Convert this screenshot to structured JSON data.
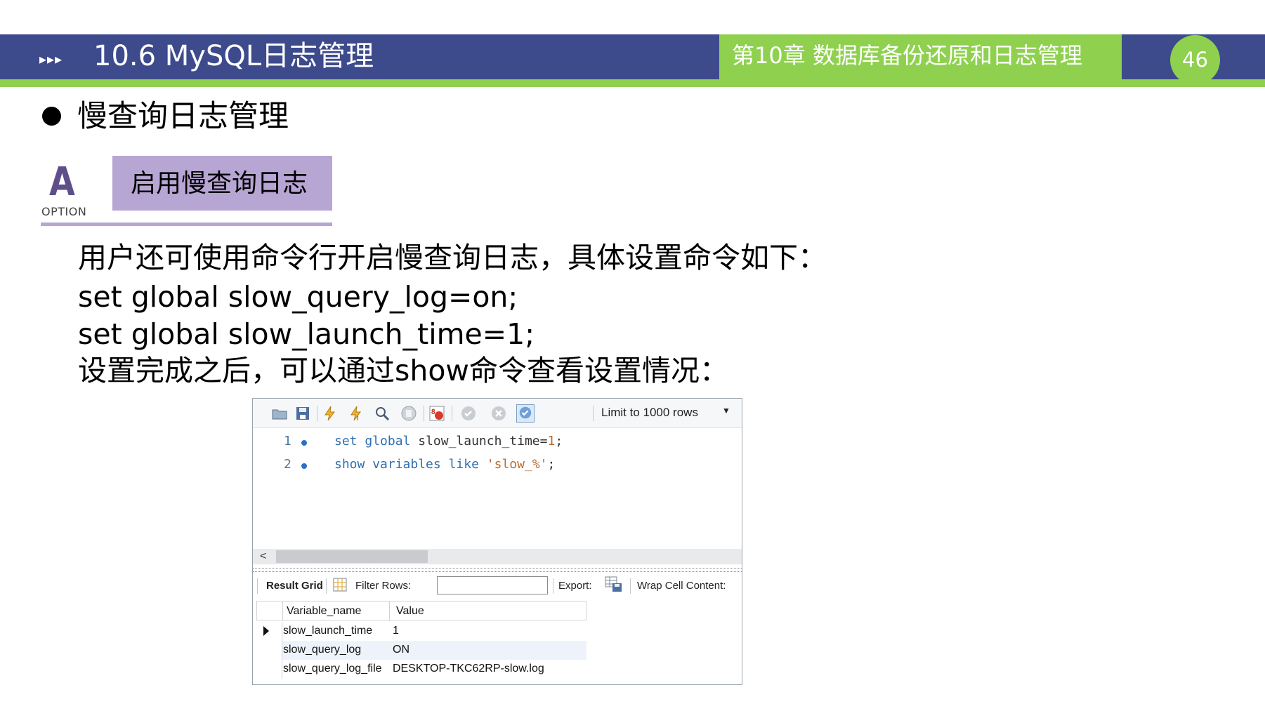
{
  "header": {
    "arrows": "▸▸▸",
    "section_title": "10.6  MySQL日志管理",
    "chapter_title": "第10章   数据库备份还原和日志管理",
    "page_number": "46",
    "colors": {
      "primary": "#3d4a8c",
      "accent": "#8fd14f"
    }
  },
  "bullet_heading": "慢查询日志管理",
  "option": {
    "letter": "A",
    "label": "OPTION",
    "title": "启用慢查询日志",
    "color": "#b7a6d3"
  },
  "body": {
    "line1": "用户还可使用命令行开启慢查询日志，具体设置命令如下：",
    "line2": "set global slow_query_log=on;",
    "line3": "set global slow_launch_time=1;",
    "line4": "设置完成之后，可以通过show命令查看设置情况："
  },
  "workbench": {
    "toolbar": {
      "icons": [
        "open-folder-icon",
        "save-icon",
        "execute-icon",
        "execute-current-icon",
        "explain-icon",
        "stop-icon",
        "toggle-error-icon",
        "commit-icon",
        "rollback-icon",
        "autocommit-icon"
      ],
      "limit_label": "Limit to 1000 rows"
    },
    "editor": {
      "lines": [
        {
          "num": "1",
          "kw1": "set",
          "kw2": "global",
          "rest": "slow_launch_time=",
          "num_val": "1",
          "end": ";"
        },
        {
          "num": "2",
          "kw1": "show",
          "kw2": "variables",
          "kw3": "like",
          "str": "'slow_%'",
          "end": ";"
        }
      ]
    },
    "result_toolbar": {
      "result_grid": "Result Grid",
      "filter_rows": "Filter Rows:",
      "export": "Export:",
      "wrap": "Wrap Cell Content:"
    },
    "grid": {
      "headers": [
        "Variable_name",
        "Value"
      ],
      "rows": [
        {
          "name": "slow_launch_time",
          "value": "1"
        },
        {
          "name": "slow_query_log",
          "value": "ON"
        },
        {
          "name": "slow_query_log_file",
          "value": "DESKTOP-TKC62RP-slow.log"
        }
      ]
    }
  }
}
